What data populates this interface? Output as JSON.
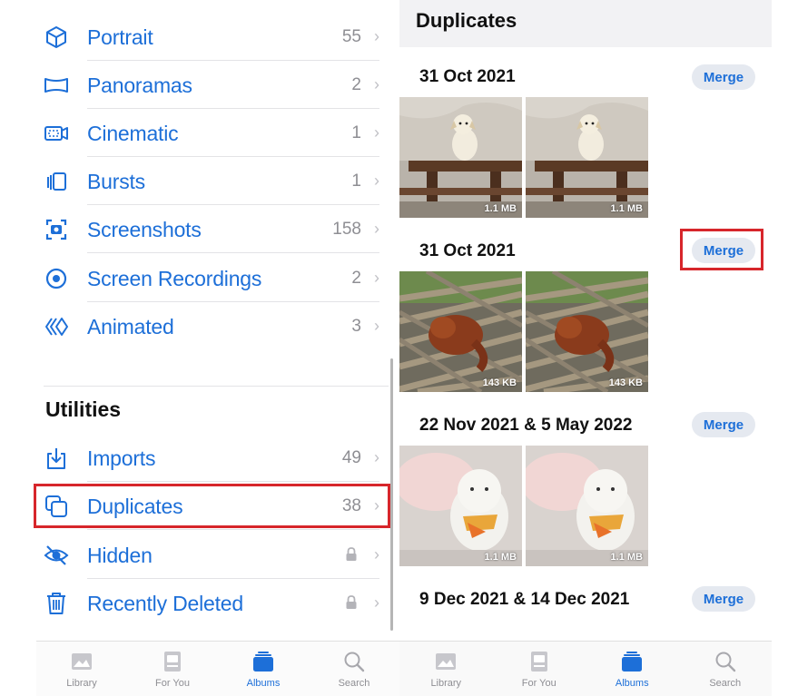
{
  "albums": {
    "media_types": [
      {
        "label": "Portrait",
        "count": "55",
        "icon": "portrait-cube-icon"
      },
      {
        "label": "Panoramas",
        "count": "2",
        "icon": "panorama-icon"
      },
      {
        "label": "Cinematic",
        "count": "1",
        "icon": "cinematic-icon"
      },
      {
        "label": "Bursts",
        "count": "1",
        "icon": "bursts-icon"
      },
      {
        "label": "Screenshots",
        "count": "158",
        "icon": "screenshot-icon"
      },
      {
        "label": "Screen Recordings",
        "count": "2",
        "icon": "screen-recording-icon"
      },
      {
        "label": "Animated",
        "count": "3",
        "icon": "animated-icon"
      }
    ],
    "utilities_title": "Utilities",
    "utilities": [
      {
        "label": "Imports",
        "count": "49",
        "icon": "import-icon"
      },
      {
        "label": "Duplicates",
        "count": "38",
        "icon": "duplicates-icon"
      },
      {
        "label": "Hidden",
        "count": "",
        "icon": "hidden-eye-icon"
      },
      {
        "label": "Recently Deleted",
        "count": "",
        "icon": "trash-icon"
      }
    ],
    "chevron": "›"
  },
  "duplicates": {
    "title": "Duplicates",
    "merge_label": "Merge",
    "groups": [
      {
        "date": "31 Oct 2021",
        "sizes": [
          "1.1 MB",
          "1.1 MB"
        ]
      },
      {
        "date": "31 Oct 2021",
        "sizes": [
          "143 KB",
          "143 KB"
        ]
      },
      {
        "date": "22 Nov 2021 & 5 May 2022",
        "sizes": [
          "1.1 MB",
          "1.1 MB"
        ]
      },
      {
        "date": "9 Dec 2021 & 14 Dec 2021",
        "sizes": []
      }
    ]
  },
  "tabbar": {
    "tabs": [
      "Library",
      "For You",
      "Albums",
      "Search"
    ],
    "active": "Albums"
  },
  "colors": {
    "accent": "#1d6fd8",
    "highlight": "#d7262b",
    "secondary_text": "#8e8e93"
  }
}
